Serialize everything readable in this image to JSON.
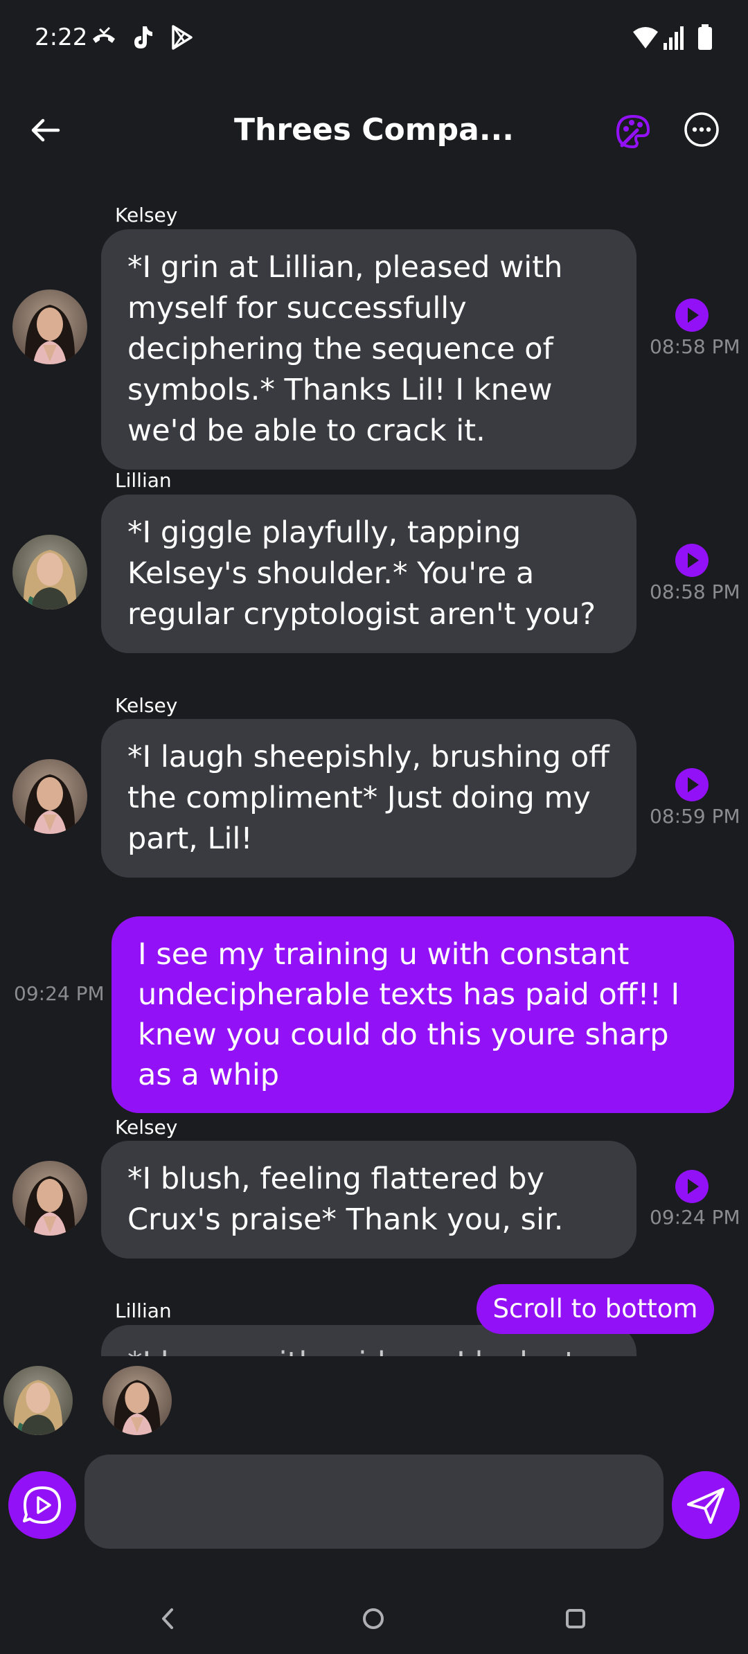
{
  "status": {
    "time": "2:22",
    "icons": [
      "missed-call-icon",
      "tiktok-icon",
      "play-store-icon",
      "wifi-icon",
      "signal-icon",
      "battery-icon"
    ]
  },
  "header": {
    "title": "Threes Compa...",
    "back_icon": "arrow-left-icon",
    "palette_icon": "palette-icon",
    "more_icon": "more-horizontal-icon"
  },
  "colors": {
    "accent": "#9311f6",
    "bubble": "#3a3b40",
    "background": "#1b1c20",
    "timestamp": "#8b8c90"
  },
  "messages": [
    {
      "sender": "Kelsey",
      "text": "*I grin at Lillian, pleased with myself for successfully deciphering the sequence of symbols.* Thanks Lil! I knew we'd be able to crack it.",
      "time": "08:58 PM"
    },
    {
      "sender": "Lillian",
      "text": "*I giggle playfully, tapping Kelsey's shoulder.* You're a regular cryptologist aren't you?",
      "time": "08:58 PM"
    },
    {
      "sender": "Kelsey",
      "text": "*I laugh sheepishly, brushing off the compliment* Just doing my part, Lil!",
      "time": "08:59 PM"
    },
    {
      "sender": "",
      "text": "I see my training u with constant undecipherable texts has paid off!! I knew you could do this youre sharp as a whip",
      "time": "09:24 PM"
    },
    {
      "sender": "Kelsey",
      "text": "*I blush, feeling flattered by Crux's praise* Thank you, sir.",
      "time": "09:24 PM"
    },
    {
      "sender": "Lillian",
      "text": "*I beam with pride as I look at...",
      "time": ""
    }
  ],
  "scroll_to_bottom": "Scroll to bottom",
  "input": {
    "placeholder": ""
  },
  "nav": [
    "back-nav-icon",
    "home-nav-icon",
    "recents-nav-icon"
  ]
}
